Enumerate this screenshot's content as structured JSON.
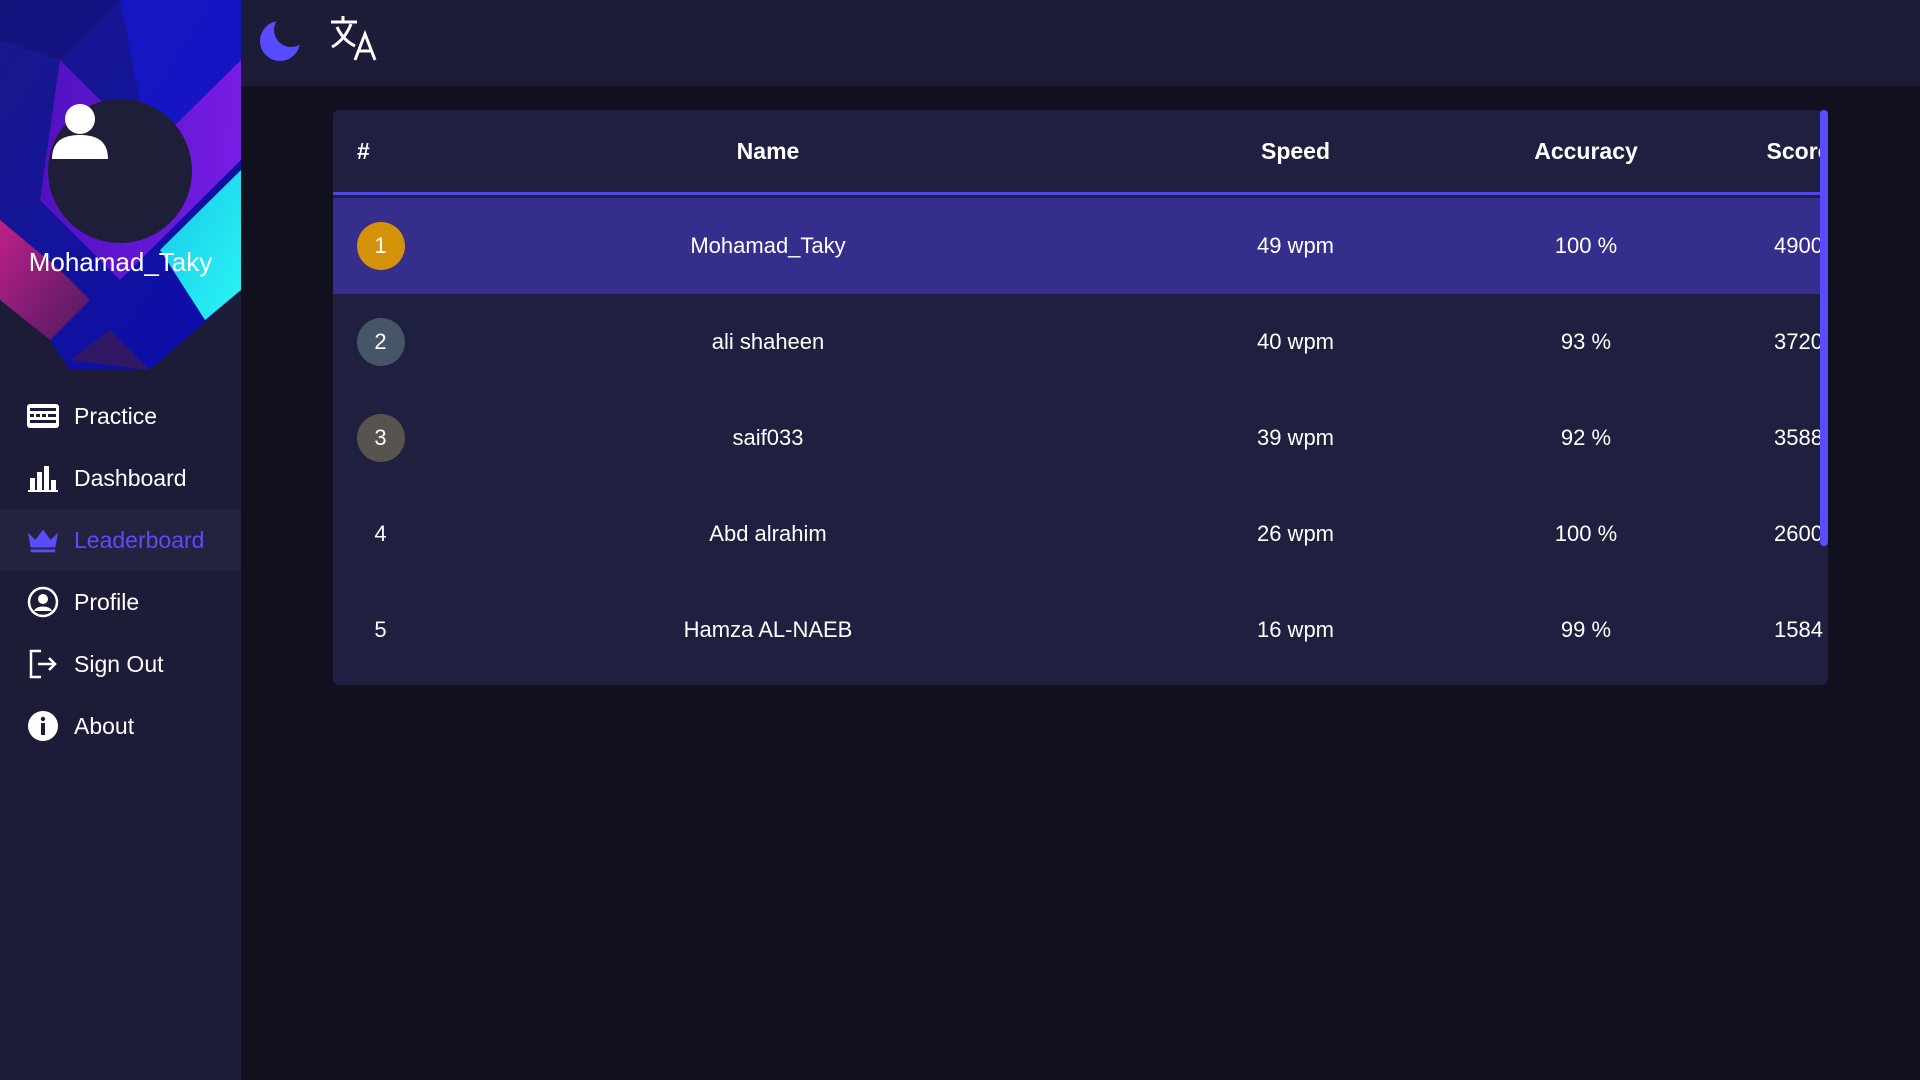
{
  "user": {
    "name": "Mohamad_Taky"
  },
  "nav": [
    {
      "label": "Practice",
      "icon": "keyboard-icon"
    },
    {
      "label": "Dashboard",
      "icon": "bar-chart-icon"
    },
    {
      "label": "Leaderboard",
      "icon": "crown-icon",
      "active": true
    },
    {
      "label": "Profile",
      "icon": "user-circle-icon"
    },
    {
      "label": "Sign Out",
      "icon": "sign-out-icon"
    },
    {
      "label": "About",
      "icon": "info-icon"
    }
  ],
  "topbar": {
    "icons": [
      "moon-icon",
      "translate-icon"
    ]
  },
  "colors": {
    "accent": "#5b4bff",
    "gold": "#d4910a",
    "silver": "#475569",
    "bronze": "#57534e",
    "highlight_row": "#352e8c"
  },
  "table": {
    "headers": {
      "rank": "#",
      "name": "Name",
      "speed": "Speed",
      "accuracy": "Accuracy",
      "score": "Score"
    },
    "rows": [
      {
        "rank": "1",
        "name": "Mohamad_Taky",
        "speed": "49 wpm",
        "accuracy": "100 %",
        "score": "4900"
      },
      {
        "rank": "2",
        "name": "ali shaheen",
        "speed": "40 wpm",
        "accuracy": "93 %",
        "score": "3720"
      },
      {
        "rank": "3",
        "name": "saif033",
        "speed": "39 wpm",
        "accuracy": "92 %",
        "score": "3588"
      },
      {
        "rank": "4",
        "name": "Abd alrahim",
        "speed": "26 wpm",
        "accuracy": "100 %",
        "score": "2600"
      },
      {
        "rank": "5",
        "name": "Hamza AL-NAEB",
        "speed": "16 wpm",
        "accuracy": "99 %",
        "score": "1584"
      }
    ]
  }
}
